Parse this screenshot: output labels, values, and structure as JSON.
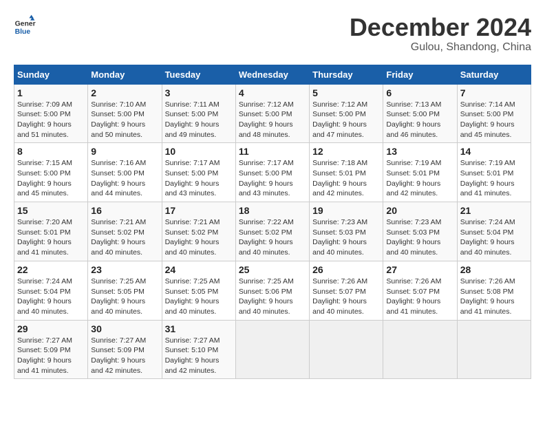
{
  "logo": {
    "line1": "General",
    "line2": "Blue"
  },
  "title": "December 2024",
  "subtitle": "Gulou, Shandong, China",
  "days_header": [
    "Sunday",
    "Monday",
    "Tuesday",
    "Wednesday",
    "Thursday",
    "Friday",
    "Saturday"
  ],
  "weeks": [
    [
      {
        "day": "1",
        "rise": "7:09 AM",
        "set": "5:00 PM",
        "daylight": "9 hours and 51 minutes."
      },
      {
        "day": "2",
        "rise": "7:10 AM",
        "set": "5:00 PM",
        "daylight": "9 hours and 50 minutes."
      },
      {
        "day": "3",
        "rise": "7:11 AM",
        "set": "5:00 PM",
        "daylight": "9 hours and 49 minutes."
      },
      {
        "day": "4",
        "rise": "7:12 AM",
        "set": "5:00 PM",
        "daylight": "9 hours and 48 minutes."
      },
      {
        "day": "5",
        "rise": "7:12 AM",
        "set": "5:00 PM",
        "daylight": "9 hours and 47 minutes."
      },
      {
        "day": "6",
        "rise": "7:13 AM",
        "set": "5:00 PM",
        "daylight": "9 hours and 46 minutes."
      },
      {
        "day": "7",
        "rise": "7:14 AM",
        "set": "5:00 PM",
        "daylight": "9 hours and 45 minutes."
      }
    ],
    [
      {
        "day": "8",
        "rise": "7:15 AM",
        "set": "5:00 PM",
        "daylight": "9 hours and 45 minutes."
      },
      {
        "day": "9",
        "rise": "7:16 AM",
        "set": "5:00 PM",
        "daylight": "9 hours and 44 minutes."
      },
      {
        "day": "10",
        "rise": "7:17 AM",
        "set": "5:00 PM",
        "daylight": "9 hours and 43 minutes."
      },
      {
        "day": "11",
        "rise": "7:17 AM",
        "set": "5:00 PM",
        "daylight": "9 hours and 43 minutes."
      },
      {
        "day": "12",
        "rise": "7:18 AM",
        "set": "5:01 PM",
        "daylight": "9 hours and 42 minutes."
      },
      {
        "day": "13",
        "rise": "7:19 AM",
        "set": "5:01 PM",
        "daylight": "9 hours and 42 minutes."
      },
      {
        "day": "14",
        "rise": "7:19 AM",
        "set": "5:01 PM",
        "daylight": "9 hours and 41 minutes."
      }
    ],
    [
      {
        "day": "15",
        "rise": "7:20 AM",
        "set": "5:01 PM",
        "daylight": "9 hours and 41 minutes."
      },
      {
        "day": "16",
        "rise": "7:21 AM",
        "set": "5:02 PM",
        "daylight": "9 hours and 40 minutes."
      },
      {
        "day": "17",
        "rise": "7:21 AM",
        "set": "5:02 PM",
        "daylight": "9 hours and 40 minutes."
      },
      {
        "day": "18",
        "rise": "7:22 AM",
        "set": "5:02 PM",
        "daylight": "9 hours and 40 minutes."
      },
      {
        "day": "19",
        "rise": "7:23 AM",
        "set": "5:03 PM",
        "daylight": "9 hours and 40 minutes."
      },
      {
        "day": "20",
        "rise": "7:23 AM",
        "set": "5:03 PM",
        "daylight": "9 hours and 40 minutes."
      },
      {
        "day": "21",
        "rise": "7:24 AM",
        "set": "5:04 PM",
        "daylight": "9 hours and 40 minutes."
      }
    ],
    [
      {
        "day": "22",
        "rise": "7:24 AM",
        "set": "5:04 PM",
        "daylight": "9 hours and 40 minutes."
      },
      {
        "day": "23",
        "rise": "7:25 AM",
        "set": "5:05 PM",
        "daylight": "9 hours and 40 minutes."
      },
      {
        "day": "24",
        "rise": "7:25 AM",
        "set": "5:05 PM",
        "daylight": "9 hours and 40 minutes."
      },
      {
        "day": "25",
        "rise": "7:25 AM",
        "set": "5:06 PM",
        "daylight": "9 hours and 40 minutes."
      },
      {
        "day": "26",
        "rise": "7:26 AM",
        "set": "5:07 PM",
        "daylight": "9 hours and 40 minutes."
      },
      {
        "day": "27",
        "rise": "7:26 AM",
        "set": "5:07 PM",
        "daylight": "9 hours and 41 minutes."
      },
      {
        "day": "28",
        "rise": "7:26 AM",
        "set": "5:08 PM",
        "daylight": "9 hours and 41 minutes."
      }
    ],
    [
      {
        "day": "29",
        "rise": "7:27 AM",
        "set": "5:09 PM",
        "daylight": "9 hours and 41 minutes."
      },
      {
        "day": "30",
        "rise": "7:27 AM",
        "set": "5:09 PM",
        "daylight": "9 hours and 42 minutes."
      },
      {
        "day": "31",
        "rise": "7:27 AM",
        "set": "5:10 PM",
        "daylight": "9 hours and 42 minutes."
      },
      null,
      null,
      null,
      null
    ]
  ]
}
